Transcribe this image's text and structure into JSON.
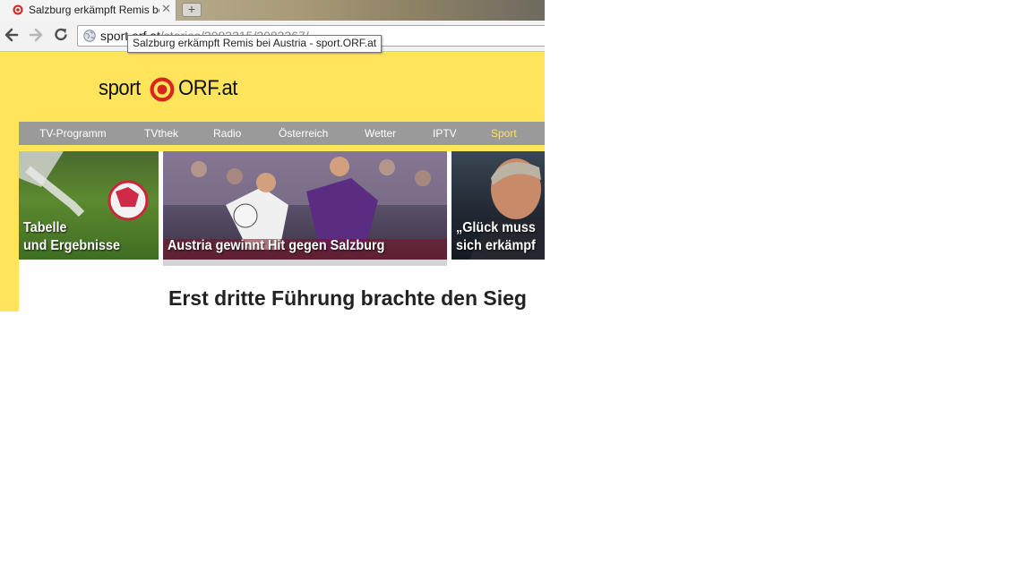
{
  "browser": {
    "tab": {
      "title": "Salzburg erkämpft Remis be",
      "close": "✕",
      "new_tab": "+"
    },
    "toolbar": {
      "back_icon": "arrow-left-icon",
      "forward_icon": "arrow-right-icon",
      "reload_icon": "reload-icon"
    },
    "omnibox": {
      "url_host": "sport.orf.at",
      "url_path": "/stories/2083315/2083367/"
    },
    "tooltip": "Salzburg erkämpft Remis bei Austria - sport.ORF.at"
  },
  "site": {
    "logo_left": "sport",
    "logo_right": "ORF.at",
    "brand_color": "#ffe45c",
    "nav": [
      {
        "label": "TV-Programm",
        "active": false
      },
      {
        "label": "TVthek",
        "active": false
      },
      {
        "label": "Radio",
        "active": false
      },
      {
        "label": "Österreich",
        "active": false
      },
      {
        "label": "Wetter",
        "active": false
      },
      {
        "label": "IPTV",
        "active": false
      },
      {
        "label": "Sport",
        "active": true
      }
    ],
    "teasers": [
      {
        "line1": "Tabelle",
        "line2": "und Ergebnisse"
      },
      {
        "line1": "Austria gewinnt Hit gegen Salzburg"
      },
      {
        "line1": "„Glück muss",
        "line2": "sich erkämpf"
      }
    ],
    "headline": "Erst dritte Führung brachte den Sieg"
  }
}
